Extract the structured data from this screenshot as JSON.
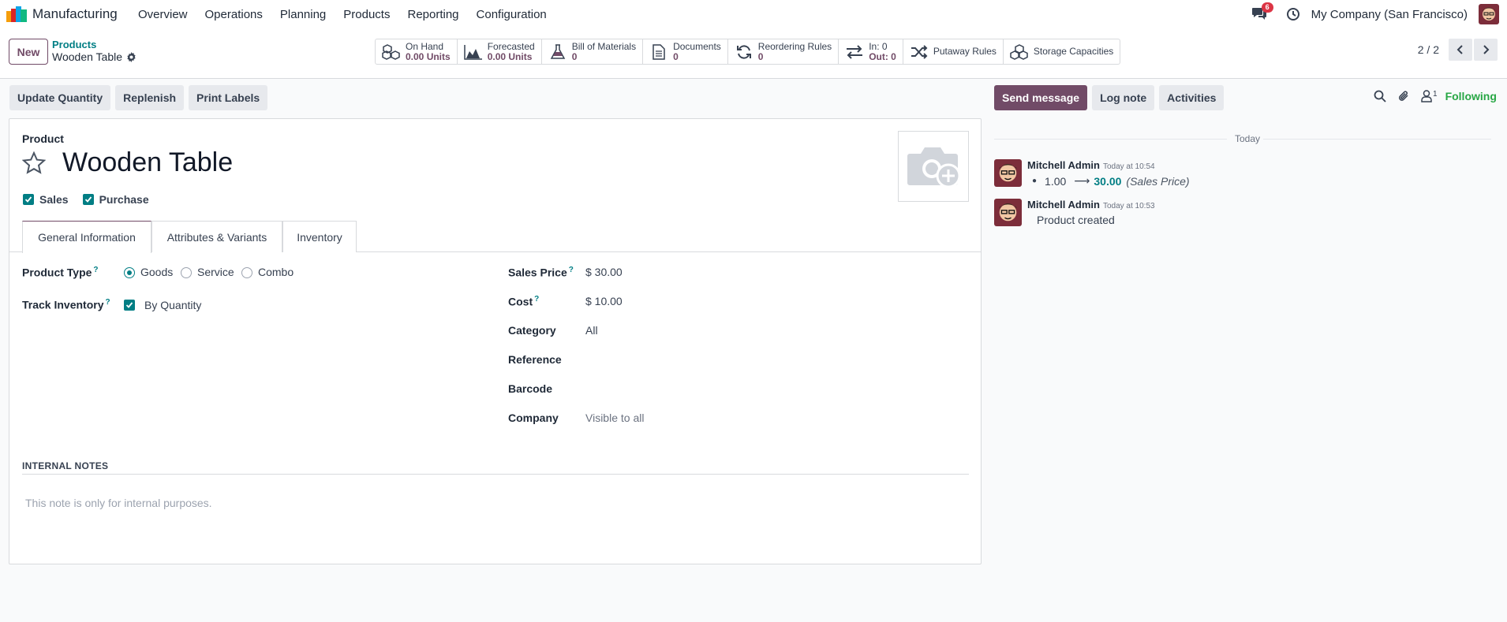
{
  "app": {
    "name": "Manufacturing"
  },
  "menu": [
    "Overview",
    "Operations",
    "Planning",
    "Products",
    "Reporting",
    "Configuration"
  ],
  "nav": {
    "chat_badge": "6",
    "company": "My Company (San Francisco)"
  },
  "control": {
    "new_label": "New",
    "breadcrumb_parent": "Products",
    "breadcrumb_current": "Wooden Table",
    "pager": "2 / 2"
  },
  "smart_buttons": [
    {
      "icon": "cubes-icon",
      "label": "On Hand",
      "value": "0.00 Units"
    },
    {
      "icon": "area-chart-icon",
      "label": "Forecasted",
      "value": "0.00 Units"
    },
    {
      "icon": "flask-icon",
      "label": "Bill of Materials",
      "value": "0"
    },
    {
      "icon": "document-icon",
      "label": "Documents",
      "value": "0"
    },
    {
      "icon": "refresh-icon",
      "label": "Reordering Rules",
      "value": "0"
    },
    {
      "icon": "exchange-icon",
      "label": "In: 0",
      "value": "Out: 0"
    },
    {
      "icon": "random-icon",
      "label": "Putaway Rules",
      "value": ""
    },
    {
      "icon": "cubes-icon",
      "label": "Storage Capacities",
      "value": ""
    }
  ],
  "actions": {
    "update_quantity": "Update Quantity",
    "replenish": "Replenish",
    "print_labels": "Print Labels"
  },
  "form": {
    "product_label": "Product",
    "product_name": "Wooden Table",
    "sales_label": "Sales",
    "purchase_label": "Purchase",
    "tabs": [
      "General Information",
      "Attributes & Variants",
      "Inventory"
    ],
    "product_type_label": "Product Type",
    "product_type_options": [
      "Goods",
      "Service",
      "Combo"
    ],
    "track_inventory_label": "Track Inventory",
    "track_inventory_value": "By Quantity",
    "sales_price_label": "Sales Price",
    "sales_price_value": "$ 30.00",
    "cost_label": "Cost",
    "cost_value": "$ 10.00",
    "category_label": "Category",
    "category_value": "All",
    "reference_label": "Reference",
    "barcode_label": "Barcode",
    "company_label": "Company",
    "company_placeholder": "Visible to all",
    "help_marker": "?",
    "notes_title": "INTERNAL NOTES",
    "notes_placeholder": "This note is only for internal purposes."
  },
  "chatter": {
    "send_message": "Send message",
    "log_note": "Log note",
    "activities": "Activities",
    "followers_count": "1",
    "following": "Following",
    "today": "Today",
    "messages": [
      {
        "author": "Mitchell Admin",
        "time": "Today at 10:54",
        "old": "1.00",
        "arrow": "⟶",
        "new": "30.00",
        "field": "(Sales Price)"
      },
      {
        "author": "Mitchell Admin",
        "time": "Today at 10:53",
        "body": "Product created"
      }
    ]
  },
  "colors": {
    "brand": "#714b67",
    "accent": "#017e84",
    "following": "#28a745",
    "badge": "#dc3545"
  }
}
